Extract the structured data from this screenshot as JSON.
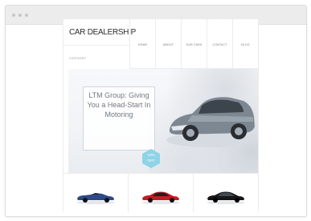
{
  "window": {
    "controls": [
      "close-dot",
      "minimize-dot",
      "maximize-dot"
    ]
  },
  "site": {
    "logo": "CAR DEALERSHIP",
    "nav": [
      "HOME",
      "ABOUT",
      "OUR CARS",
      "CONTACT",
      "BLOG"
    ],
    "breadcrumb": "CATEGORY",
    "hero": {
      "headline": "LTM Group: Giving You a Head-Start In Motoring",
      "badge_line1": "10%",
      "badge_line2": "OFF"
    },
    "products": [
      {
        "name": "blue-convertible",
        "color": "#2d4a86"
      },
      {
        "name": "red-coupe",
        "color": "#c21d22"
      },
      {
        "name": "black-sedan",
        "color": "#161616"
      }
    ]
  }
}
